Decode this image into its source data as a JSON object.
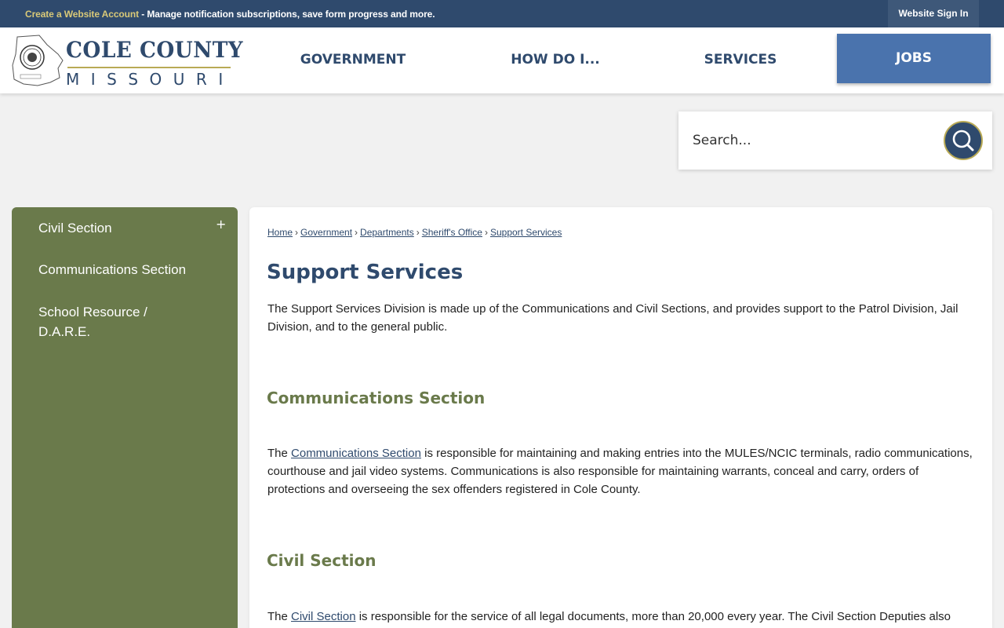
{
  "topbar": {
    "create_account": "Create a Website Account",
    "message": " - Manage notification subscriptions, save form progress and more.",
    "sign_in": "Website Sign In"
  },
  "logo": {
    "line1": "COLE COUNTY",
    "line2": "MISSOURI"
  },
  "nav": {
    "government": "GOVERNMENT",
    "how_do_i": "HOW DO I...",
    "services": "SERVICES",
    "jobs": "JOBS"
  },
  "search": {
    "placeholder": "Search..."
  },
  "sidebar": {
    "items": [
      {
        "label": "Civil Section",
        "expander": "+"
      },
      {
        "label": "Communications Section"
      },
      {
        "label": "School Resource / D.A.R.E."
      }
    ]
  },
  "breadcrumb": [
    "Home",
    "Government",
    "Departments",
    "Sheriff's Office",
    "Support Services"
  ],
  "breadcrumb_sep": "›",
  "page": {
    "title": "Support Services",
    "intro": "The Support Services Division is made up of the Communications and Civil Sections, and provides support to the Patrol Division, Jail Division, and to the general public.",
    "communications": {
      "heading": "Communications Section",
      "lead": "The ",
      "link": "Communications Section",
      "text": " is responsible for maintaining and making entries into the MULES/NCIC terminals, radio communications, courthouse and jail video systems. Communications is also responsible for maintaining warrants, conceal and carry, orders of protections and overseeing the sex offenders registered in Cole County."
    },
    "civil": {
      "heading": "Civil Section",
      "lead": "The ",
      "link": "Civil Section",
      "text": " is responsible for the service of all legal documents, more than 20,000 every year. The Civil Section Deputies also"
    }
  },
  "colors": {
    "navy": "#2f4a6d",
    "gold": "#d9c978",
    "olive": "#6a7a4b",
    "jobs_blue": "#4a73ad"
  }
}
